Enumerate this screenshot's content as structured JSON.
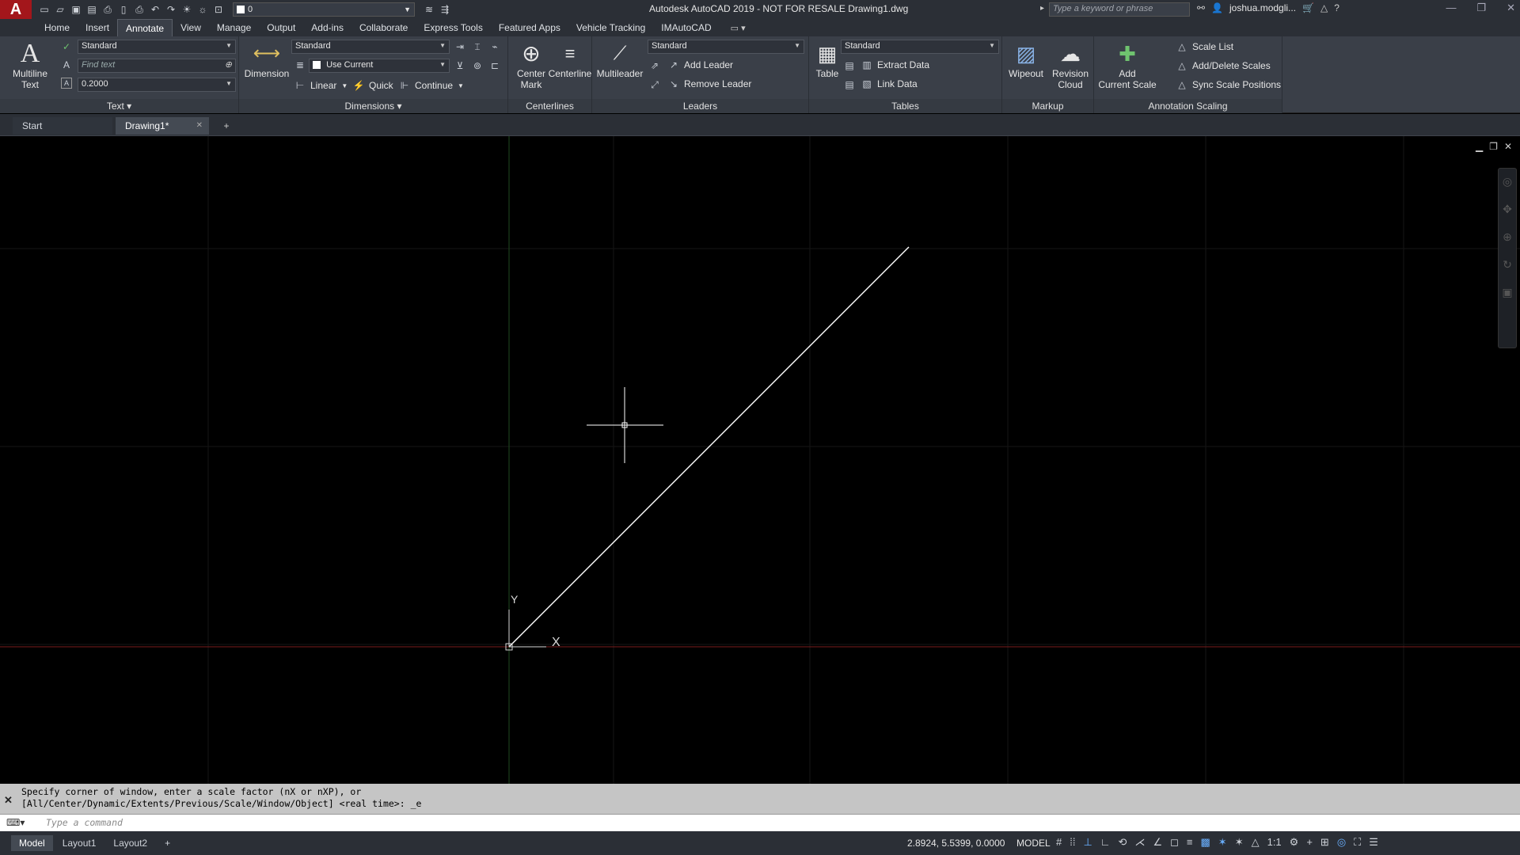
{
  "app": {
    "logo": "A",
    "title": "Autodesk AutoCAD 2019 - NOT FOR RESALE    Drawing1.dwg",
    "workspace": "0",
    "search_placeholder": "Type a keyword or phrase",
    "user": "joshua.modgli..."
  },
  "menu": {
    "tabs": [
      "Home",
      "Insert",
      "Annotate",
      "View",
      "Manage",
      "Output",
      "Add-ins",
      "Collaborate",
      "Express Tools",
      "Featured Apps",
      "Vehicle Tracking",
      "IMAutoCAD"
    ],
    "active": "Annotate"
  },
  "ribbon": {
    "text_panel": {
      "multiline_label": "Multiline\nText",
      "style": "Standard",
      "find_placeholder": "Find text",
      "height": "0.2000",
      "title": "Text ▾"
    },
    "dimensions_panel": {
      "dimension_label": "Dimension",
      "style": "Standard",
      "layer": "Use Current",
      "linear": "Linear",
      "quick": "Quick",
      "continue": "Continue",
      "title": "Dimensions ▾"
    },
    "centerlines_panel": {
      "center_mark": "Center\nMark",
      "centerline": "Centerline",
      "title": "Centerlines"
    },
    "leaders_panel": {
      "multileader": "Multileader",
      "style": "Standard",
      "add_leader": "Add Leader",
      "remove_leader": "Remove Leader",
      "title": "Leaders"
    },
    "tables_panel": {
      "table": "Table",
      "style": "Standard",
      "extract_data": "Extract Data",
      "link_data": "Link Data",
      "title": "Tables"
    },
    "markup_panel": {
      "wipeout": "Wipeout",
      "revision_cloud": "Revision\nCloud",
      "title": "Markup"
    },
    "annotation_scaling_panel": {
      "add_current_scale": "Add\nCurrent Scale",
      "scale_list": "Scale List",
      "add_delete_scales": "Add/Delete Scales",
      "sync_scale_positions": "Sync Scale Positions",
      "title": "Annotation Scaling"
    }
  },
  "doc_tabs": {
    "start": "Start",
    "active": "Drawing1*",
    "plus": "+"
  },
  "canvas": {
    "ucs_x": "X",
    "ucs_y": "Y",
    "colors": {
      "background": "#000000",
      "x_axis": "#7a1d1d",
      "y_axis": "#1f4a1f",
      "line": "#ffffff"
    }
  },
  "command": {
    "history_line1": "Specify corner of window, enter a scale factor (nX or nXP), or",
    "history_line2": "[All/Center/Dynamic/Extents/Previous/Scale/Window/Object] <real time>: _e",
    "placeholder": "Type a command"
  },
  "status": {
    "layout_tabs": [
      "Model",
      "Layout1",
      "Layout2"
    ],
    "plus": "+",
    "coords": "2.8924, 5.5399, 0.0000",
    "mode": "MODEL",
    "scale": "1:1"
  }
}
